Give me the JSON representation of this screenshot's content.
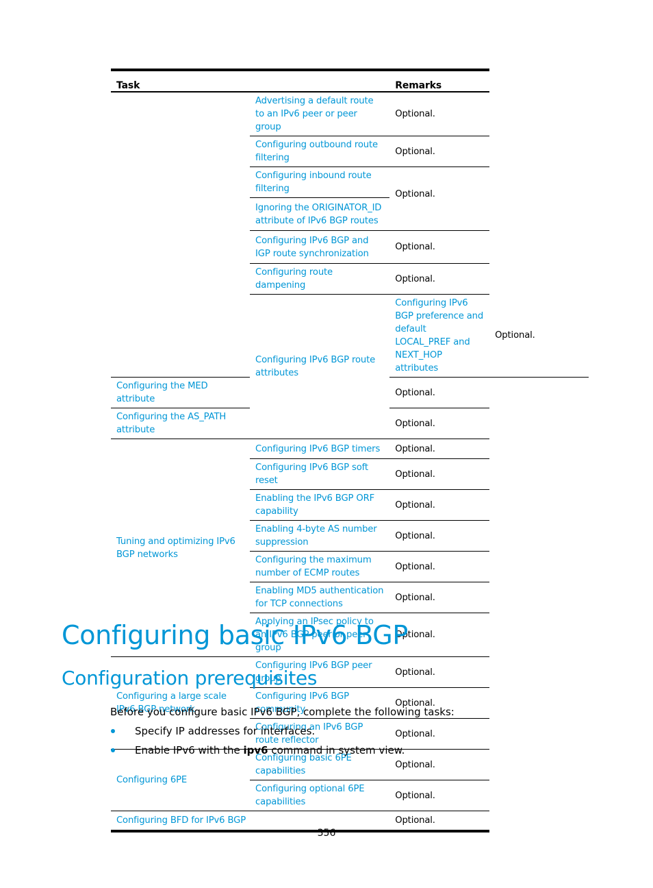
{
  "table": {
    "headers": {
      "task": "Task",
      "remarks": "Remarks"
    },
    "groups": [
      {
        "label": "",
        "rows": [
          {
            "task": "Advertising a default route to an IPv6 peer or peer group",
            "remark": "Optional."
          },
          {
            "task": "Configuring outbound route filtering",
            "remark": "Optional."
          },
          {
            "task": "Configuring inbound route filtering",
            "remark": "Optional."
          },
          {
            "task": "Ignoring the ORIGINATOR_ID attribute of IPv6 BGP routes",
            "remark": ""
          },
          {
            "task": "Configuring IPv6 BGP and IGP route synchronization",
            "remark": "Optional."
          },
          {
            "task": "Configuring route dampening",
            "remark": "Optional."
          }
        ]
      },
      {
        "label": "Configuring IPv6 BGP route attributes",
        "rows": [
          {
            "task": "Configuring IPv6 BGP preference and default LOCAL_PREF and NEXT_HOP attributes",
            "remark": "Optional."
          },
          {
            "task": "Configuring the MED attribute",
            "remark": "Optional."
          },
          {
            "task": "Configuring the AS_PATH attribute",
            "remark": "Optional."
          }
        ]
      },
      {
        "label": "Tuning and optimizing IPv6 BGP networks",
        "rows": [
          {
            "task": "Configuring IPv6 BGP timers",
            "remark": "Optional."
          },
          {
            "task": "Configuring IPv6 BGP soft reset",
            "remark": "Optional."
          },
          {
            "task": "Enabling the IPv6 BGP ORF capability",
            "remark": "Optional."
          },
          {
            "task": "Enabling 4-byte AS number suppression",
            "remark": "Optional."
          },
          {
            "task": "Configuring the maximum number of ECMP routes",
            "remark": "Optional."
          },
          {
            "task": "Enabling MD5 authentication for TCP connections",
            "remark": "Optional."
          },
          {
            "task": "Applying an IPsec policy to an IPv6 BGP peer or peer group",
            "remark": "Optional."
          }
        ]
      },
      {
        "label": "Configuring a large scale IPv6 BGP network",
        "rows": [
          {
            "task": "Configuring IPv6 BGP peer group",
            "remark": "Optional."
          },
          {
            "task": "Configuring IPv6 BGP community",
            "remark": "Optional."
          },
          {
            "task": "Configuring an IPv6 BGP route reflector",
            "remark": "Optional."
          }
        ]
      },
      {
        "label": "Configuring 6PE",
        "rows": [
          {
            "task": "Configuring basic 6PE capabilities",
            "remark": "Optional."
          },
          {
            "task": "Configuring optional 6PE capabilities",
            "remark": "Optional."
          }
        ]
      }
    ],
    "final_row": {
      "task": "Configuring BFD for IPv6 BGP",
      "remark": "Optional."
    }
  },
  "heading1": "Configuring basic IPv6 BGP",
  "heading2": "Configuration prerequisites",
  "intro": "Before you configure basic IPv6 BGP, complete the following tasks:",
  "bullets": [
    {
      "text": "Specify IP addresses for interfaces."
    },
    {
      "pre": "Enable IPv6 with the ",
      "bold": "ipv6",
      "post": " command in system view."
    }
  ],
  "page_number": "356"
}
